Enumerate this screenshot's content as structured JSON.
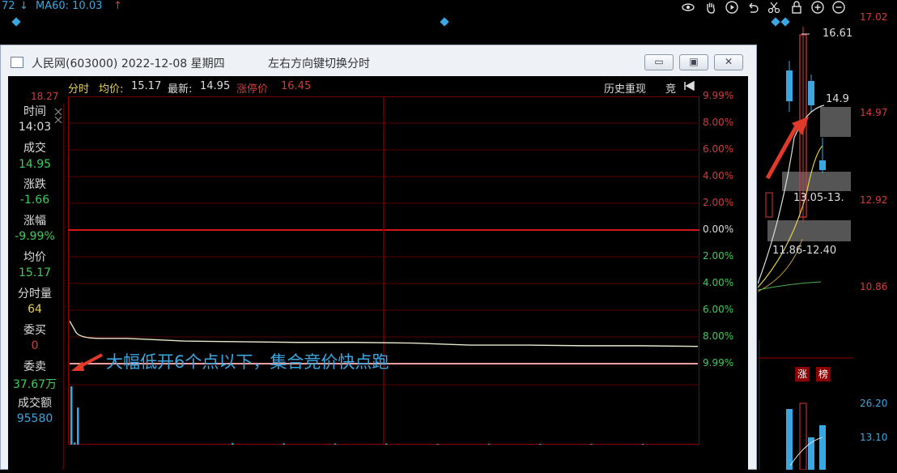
{
  "background_top": {
    "left_value": "72",
    "ma_label": "MA60: 10.03",
    "scale_right": [
      "17.02",
      "14.97",
      "12.92",
      "10.86",
      "26.20",
      "13.10"
    ]
  },
  "right_panel": {
    "high_label": "16.61",
    "price_label": "14.9",
    "range_1": "13.05-13.",
    "range_2": "11.86-12.40",
    "badge_1": "涨",
    "badge_2": "榜"
  },
  "window": {
    "title": "人民网(603000) 2022-12-08 星期四",
    "hint": "左右方向键切换分时",
    "buttons": {
      "minimize": "▭",
      "restore": "▣",
      "close": "✕"
    }
  },
  "subheader": {
    "mode": "分时",
    "avg_label": "均价:",
    "avg_value": "15.17",
    "latest_label": "最新:",
    "latest_value": "14.95",
    "limit_label": "涨停价",
    "limit_value": "16.45",
    "history_button": "历史重现",
    "vote_button": "竞",
    "top_left_price": "18.27"
  },
  "left_panel": {
    "time_label": "时间",
    "time_value": "14:03",
    "deal_label": "成交",
    "deal_value": "14.95",
    "change_label": "涨跌",
    "change_value": "-1.66",
    "pct_label": "涨幅",
    "pct_value": "-9.99%",
    "avg_label": "均价",
    "avg_value": "15.17",
    "vol_label": "分时量",
    "vol_value": "64",
    "bid_label": "委买",
    "bid_value": "0",
    "ask_label": "委卖",
    "ask_value": "37.67万",
    "amount_label": "成交额",
    "amount_value": "95580"
  },
  "chart_data": {
    "type": "line",
    "y_right_labels": [
      "9.99%",
      "8.00%",
      "6.00%",
      "4.00%",
      "2.00%",
      "0.00%",
      "2.00%",
      "4.00%",
      "6.00%",
      "8.00%",
      "9.99%"
    ],
    "ylim_pct": [
      -9.99,
      9.99
    ],
    "grid": true,
    "series": [
      {
        "values_pct": [
          -6.8,
          -8.1,
          -8.3,
          -8.35,
          -8.4,
          -8.4,
          -8.45,
          -8.6,
          -8.6,
          -8.65,
          -8.65,
          -8.7
        ]
      },
      {
        "values_pct": [
          -9.99,
          -9.99,
          -9.99,
          -9.99,
          -9.99,
          -9.99,
          -9.99,
          -9.99,
          -9.99,
          -9.99,
          -9.99,
          -9.99
        ]
      }
    ],
    "volume": [
      22,
      0.8,
      14,
      0.6,
      0.5,
      0.4,
      0.4,
      0.3,
      0.3,
      0.3,
      0.3,
      0.3
    ]
  },
  "annotation": "大幅低开6个点以下，集合竞价快点跑",
  "colors": {
    "up": "#d23c3c",
    "down": "#3aa7e0",
    "price_line": "#e8e8c8",
    "grid_red": "#8b0000",
    "window_bg": "#eef1f6"
  }
}
